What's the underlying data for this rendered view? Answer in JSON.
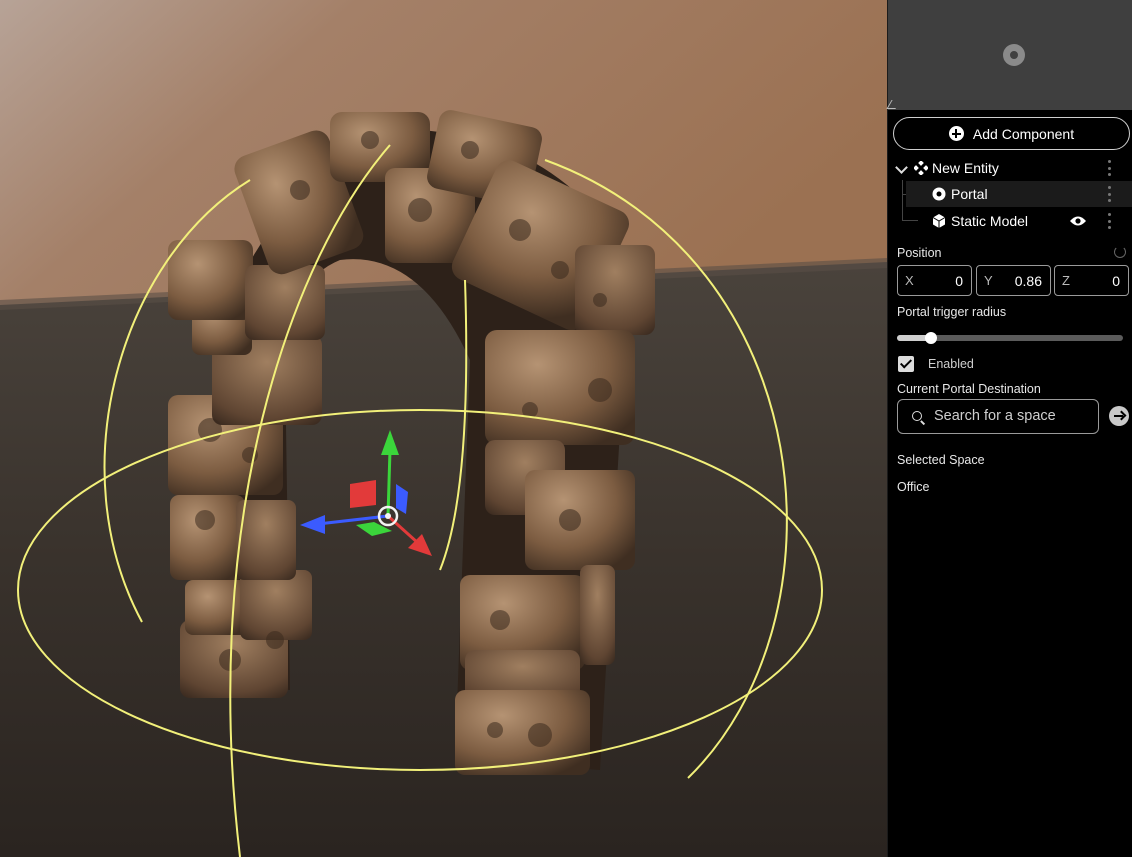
{
  "panel": {
    "add_component_label": "Add Component",
    "hierarchy": {
      "entity_label": "New Entity",
      "components": [
        {
          "label": "Portal",
          "selected": true
        },
        {
          "label": "Static Model",
          "visible": true
        }
      ]
    },
    "position": {
      "label": "Position",
      "x": {
        "axis": "X",
        "value": "0"
      },
      "y": {
        "axis": "Y",
        "value": "0.86"
      },
      "z": {
        "axis": "Z",
        "value": "0"
      }
    },
    "trigger_radius": {
      "label": "Portal trigger radius",
      "fraction": 0.15
    },
    "enabled": {
      "label": "Enabled",
      "checked": true
    },
    "destination": {
      "label": "Current Portal Destination",
      "search_placeholder": "Search for a space"
    },
    "selected_space": {
      "label": "Selected Space",
      "value": "Office"
    }
  },
  "icons": [
    "preview-model-icon",
    "plus-icon",
    "chevron-down-icon",
    "entity-icon",
    "portal-icon",
    "cube-icon",
    "eye-icon",
    "kebab-icon",
    "reset-icon",
    "search-icon",
    "arrow-right-icon"
  ],
  "colors": {
    "gizmo_x": "#e23a3a",
    "gizmo_y": "#3bd53b",
    "gizmo_z": "#3b5bff",
    "trigger_sphere": "#f2f07a"
  }
}
